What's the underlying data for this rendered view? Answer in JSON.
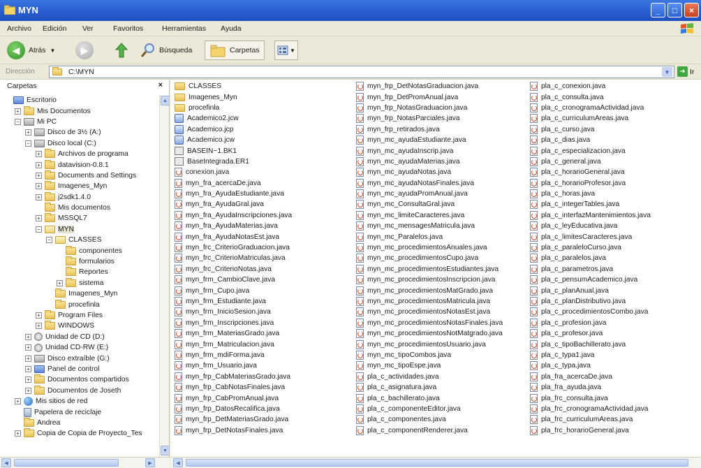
{
  "window": {
    "title": "MYN"
  },
  "menu": [
    "Archivo",
    "Edición",
    "Ver",
    "Favoritos",
    "Herramientas",
    "Ayuda"
  ],
  "toolbar": {
    "back_label": "Atrás",
    "search_label": "Búsqueda",
    "folders_label": "Carpetas"
  },
  "address": {
    "label": "Dirección",
    "path": "C:\\MYN",
    "go_label": "Ir"
  },
  "folders_pane": {
    "title": "Carpetas",
    "close": "×"
  },
  "tree": [
    {
      "label": "Escritorio",
      "level": 0,
      "exp": "",
      "icon": "blue",
      "name": "desktop"
    },
    {
      "label": "Mis Documentos",
      "level": 1,
      "exp": "+",
      "icon": "folder",
      "name": "my-documents"
    },
    {
      "label": "Mi PC",
      "level": 1,
      "exp": "−",
      "icon": "gray",
      "name": "my-computer"
    },
    {
      "label": "Disco de 3½ (A:)",
      "level": 2,
      "exp": "+",
      "icon": "gray",
      "name": "floppy-drive"
    },
    {
      "label": "Disco local (C:)",
      "level": 2,
      "exp": "−",
      "icon": "gray",
      "name": "local-disk-c"
    },
    {
      "label": "Archivos de programa",
      "level": 3,
      "exp": "+",
      "icon": "folder",
      "name": "program-files-folder"
    },
    {
      "label": "datavision-0.8.1",
      "level": 3,
      "exp": "+",
      "icon": "folder",
      "name": "datavision-folder"
    },
    {
      "label": "Documents and Settings",
      "level": 3,
      "exp": "+",
      "icon": "folder",
      "name": "documents-settings-folder"
    },
    {
      "label": "Imagenes_Myn",
      "level": 3,
      "exp": "+",
      "icon": "folder",
      "name": "imagenes-myn-folder"
    },
    {
      "label": "j2sdk1.4.0",
      "level": 3,
      "exp": "+",
      "icon": "folder",
      "name": "j2sdk-folder"
    },
    {
      "label": "Mis documentos",
      "level": 3,
      "exp": "",
      "icon": "folder",
      "name": "mis-documentos-folder"
    },
    {
      "label": "MSSQL7",
      "level": 3,
      "exp": "+",
      "icon": "folder",
      "name": "mssql7-folder"
    },
    {
      "label": "MYN",
      "level": 3,
      "exp": "−",
      "icon": "openfolder",
      "name": "myn-folder"
    },
    {
      "label": "CLASSES",
      "level": 4,
      "exp": "−",
      "icon": "openfolder",
      "name": "classes-folder"
    },
    {
      "label": "componentes",
      "level": 5,
      "exp": "",
      "icon": "folder",
      "name": "componentes-folder"
    },
    {
      "label": "formularios",
      "level": 5,
      "exp": "",
      "icon": "folder",
      "name": "formularios-folder"
    },
    {
      "label": "Reportes",
      "level": 5,
      "exp": "",
      "icon": "folder",
      "name": "reportes-folder"
    },
    {
      "label": "sistema",
      "level": 5,
      "exp": "+",
      "icon": "folder",
      "name": "sistema-folder"
    },
    {
      "label": "Imagenes_Myn",
      "level": 4,
      "exp": "",
      "icon": "folder",
      "name": "myn-imagenes-folder"
    },
    {
      "label": "procefinla",
      "level": 4,
      "exp": "",
      "icon": "folder",
      "name": "procefinla-folder"
    },
    {
      "label": "Program Files",
      "level": 3,
      "exp": "+",
      "icon": "folder",
      "name": "program-files-en-folder"
    },
    {
      "label": "WINDOWS",
      "level": 3,
      "exp": "+",
      "icon": "folder",
      "name": "windows-folder"
    },
    {
      "label": "Unidad de CD (D:)",
      "level": 2,
      "exp": "+",
      "icon": "cd",
      "name": "cd-drive-d"
    },
    {
      "label": "Unidad CD-RW (E:)",
      "level": 2,
      "exp": "+",
      "icon": "cd",
      "name": "cdrw-drive-e"
    },
    {
      "label": "Disco extraíble (G:)",
      "level": 2,
      "exp": "+",
      "icon": "gray",
      "name": "removable-disk-g"
    },
    {
      "label": "Panel de control",
      "level": 2,
      "exp": "+",
      "icon": "blue",
      "name": "control-panel"
    },
    {
      "label": "Documentos compartidos",
      "level": 2,
      "exp": "+",
      "icon": "folder",
      "name": "shared-documents"
    },
    {
      "label": "Documentos de Joseth",
      "level": 2,
      "exp": "+",
      "icon": "folder",
      "name": "joseth-documents"
    },
    {
      "label": "Mis sitios de red",
      "level": 1,
      "exp": "+",
      "icon": "world",
      "name": "network-places"
    },
    {
      "label": "Papelera de reciclaje",
      "level": 1,
      "exp": "",
      "icon": "recycle",
      "name": "recycle-bin"
    },
    {
      "label": "Andrea",
      "level": 1,
      "exp": "",
      "icon": "folder",
      "name": "andrea-folder"
    },
    {
      "label": "Copia de Copia de Proyecto_Tes",
      "level": 1,
      "exp": "+",
      "icon": "folder",
      "name": "proyecto-copy-folder"
    }
  ],
  "files": {
    "col1": [
      {
        "name": "CLASSES",
        "type": "dir"
      },
      {
        "name": "Imagenes_Myn",
        "type": "dir"
      },
      {
        "name": "procefinla",
        "type": "dir"
      },
      {
        "name": "Academico2.jcw",
        "type": "jcw"
      },
      {
        "name": "Academico.jcp",
        "type": "jcw"
      },
      {
        "name": "Academico.jcw",
        "type": "jcw"
      },
      {
        "name": "BASEIN~1.BK1",
        "type": "gen"
      },
      {
        "name": "BaseIntegrada.ER1",
        "type": "gen"
      },
      {
        "name": "conexion.java",
        "type": "java"
      },
      {
        "name": "myn_fra_acercaDe.java",
        "type": "java"
      },
      {
        "name": "myn_fra_AyudaEstudiante.java",
        "type": "java"
      },
      {
        "name": "myn_fra_AyudaGral.java",
        "type": "java"
      },
      {
        "name": "myn_fra_AyudaInscripciones.java",
        "type": "java"
      },
      {
        "name": "myn_fra_AyudaMaterias.java",
        "type": "java"
      },
      {
        "name": "myn_fra_AyudaNotasEst.java",
        "type": "java"
      },
      {
        "name": "myn_frc_CriterioGraduacion.java",
        "type": "java"
      },
      {
        "name": "myn_frc_CriterioMatriculas.java",
        "type": "java"
      },
      {
        "name": "myn_frc_CriterioNotas.java",
        "type": "java"
      },
      {
        "name": "myn_frm_CambioClave.java",
        "type": "java"
      },
      {
        "name": "myn_frm_Cupo.java",
        "type": "java"
      },
      {
        "name": "myn_frm_Estudiante.java",
        "type": "java"
      },
      {
        "name": "myn_frm_InicioSesion.java",
        "type": "java"
      },
      {
        "name": "myn_frm_Inscripciones.java",
        "type": "java"
      },
      {
        "name": "myn_frm_MateriasGrado.java",
        "type": "java"
      },
      {
        "name": "myn_frm_Matriculacion.java",
        "type": "java"
      },
      {
        "name": "myn_frm_mdiForma.java",
        "type": "java"
      },
      {
        "name": "myn_frm_Usuario.java",
        "type": "java"
      },
      {
        "name": "myn_frp_CabMateriasGrado.java",
        "type": "java"
      },
      {
        "name": "myn_frp_CabNotasFinales.java",
        "type": "java"
      },
      {
        "name": "myn_frp_CabPromAnual.java",
        "type": "java"
      },
      {
        "name": "myn_frp_DatosRecalifica.java",
        "type": "java"
      },
      {
        "name": "myn_frp_DetMateriasGrado.java",
        "type": "java"
      },
      {
        "name": "myn_frp_DetNotasFinales.java",
        "type": "java"
      }
    ],
    "col2": [
      {
        "name": "myn_frp_DetNotasGraduacion.java",
        "type": "java"
      },
      {
        "name": "myn_frp_DetPromAnual.java",
        "type": "java"
      },
      {
        "name": "myn_frp_NotasGraduacion.java",
        "type": "java"
      },
      {
        "name": "myn_frp_NotasParciales.java",
        "type": "java"
      },
      {
        "name": "myn_frp_retirados.java",
        "type": "java"
      },
      {
        "name": "myn_mc_ayudaEstudiante.java",
        "type": "java"
      },
      {
        "name": "myn_mc_ayudaInscrip.java",
        "type": "java"
      },
      {
        "name": "myn_mc_ayudaMaterias.java",
        "type": "java"
      },
      {
        "name": "myn_mc_ayudaNotas.java",
        "type": "java"
      },
      {
        "name": "myn_mc_ayudaNotasFinales.java",
        "type": "java"
      },
      {
        "name": "myn_mc_ayudaPromAnual.java",
        "type": "java"
      },
      {
        "name": "myn_mc_ConsultaGral.java",
        "type": "java"
      },
      {
        "name": "myn_mc_limiteCaracteres.java",
        "type": "java"
      },
      {
        "name": "myn_mc_mensagesMatricula.java",
        "type": "java"
      },
      {
        "name": "myn_mc_Paralelos.java",
        "type": "java"
      },
      {
        "name": "myn_mc_procedimientosAnuales.java",
        "type": "java"
      },
      {
        "name": "myn_mc_procedimientosCupo.java",
        "type": "java"
      },
      {
        "name": "myn_mc_procedimientosEstudiantes.java",
        "type": "java"
      },
      {
        "name": "myn_mc_procedimientosInscripcion.java",
        "type": "java"
      },
      {
        "name": "myn_mc_procedimientosMatGrado.java",
        "type": "java"
      },
      {
        "name": "myn_mc_procedimientosMatricula.java",
        "type": "java"
      },
      {
        "name": "myn_mc_procedimientosNotasEst.java",
        "type": "java"
      },
      {
        "name": "myn_mc_procedimientosNotasFinales.java",
        "type": "java"
      },
      {
        "name": "myn_mc_procedimientosNotMatgrado.java",
        "type": "java"
      },
      {
        "name": "myn_mc_procedimientosUsuario.java",
        "type": "java"
      },
      {
        "name": "myn_mc_tipoCombos.java",
        "type": "java"
      },
      {
        "name": "myn_mc_tipoEspe.java",
        "type": "java"
      },
      {
        "name": "pla_c_actividades.java",
        "type": "java"
      },
      {
        "name": "pla_c_asignatura.java",
        "type": "java"
      },
      {
        "name": "pla_c_bachillerato.java",
        "type": "java"
      },
      {
        "name": "pla_c_componenteEditor.java",
        "type": "java"
      },
      {
        "name": "pla_c_componentes.java",
        "type": "java"
      },
      {
        "name": "pla_c_componentRenderer.java",
        "type": "java"
      }
    ],
    "col3": [
      {
        "name": "pla_c_conexion.java",
        "type": "java"
      },
      {
        "name": "pla_c_consulta.java",
        "type": "java"
      },
      {
        "name": "pla_c_cronogramaActividad.java",
        "type": "java"
      },
      {
        "name": "pla_c_curriculumAreas.java",
        "type": "java"
      },
      {
        "name": "pla_c_curso.java",
        "type": "java"
      },
      {
        "name": "pla_c_dias.java",
        "type": "java"
      },
      {
        "name": "pla_c_especializacion.java",
        "type": "java"
      },
      {
        "name": "pla_c_general.java",
        "type": "java"
      },
      {
        "name": "pla_c_horarioGeneral.java",
        "type": "java"
      },
      {
        "name": "pla_c_horarioProfesor.java",
        "type": "java"
      },
      {
        "name": "pla_c_horas.java",
        "type": "java"
      },
      {
        "name": "pla_c_integerTables.java",
        "type": "java"
      },
      {
        "name": "pla_c_interfazMantenimientos.java",
        "type": "java"
      },
      {
        "name": "pla_c_leyEducativa.java",
        "type": "java"
      },
      {
        "name": "pla_c_limitesCaracteres.java",
        "type": "java"
      },
      {
        "name": "pla_c_paraleloCurso.java",
        "type": "java"
      },
      {
        "name": "pla_c_paralelos.java",
        "type": "java"
      },
      {
        "name": "pla_c_parametros.java",
        "type": "java"
      },
      {
        "name": "pla_c_pensumAcademico.java",
        "type": "java"
      },
      {
        "name": "pla_c_planAnual.java",
        "type": "java"
      },
      {
        "name": "pla_c_planDistributivo.java",
        "type": "java"
      },
      {
        "name": "pla_c_procedimientosCombo.java",
        "type": "java"
      },
      {
        "name": "pla_c_profesion.java",
        "type": "java"
      },
      {
        "name": "pla_c_profesor.java",
        "type": "java"
      },
      {
        "name": "pla_c_tipoBachillerato.java",
        "type": "java"
      },
      {
        "name": "pla_c_typa1.java",
        "type": "java"
      },
      {
        "name": "pla_c_typa.java",
        "type": "java"
      },
      {
        "name": "pla_fra_acercaDe.java",
        "type": "java"
      },
      {
        "name": "pla_fra_ayuda.java",
        "type": "java"
      },
      {
        "name": "pla_frc_consulta.java",
        "type": "java"
      },
      {
        "name": "pla_frc_cronogramaActividad.java",
        "type": "java"
      },
      {
        "name": "pla_frc_curriculumAreas.java",
        "type": "java"
      },
      {
        "name": "pla_frc_horarioGeneral.java",
        "type": "java"
      }
    ]
  }
}
